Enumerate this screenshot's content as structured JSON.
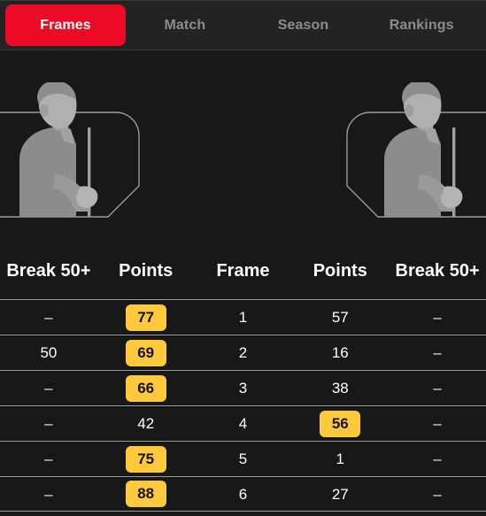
{
  "tabs": [
    {
      "label": "Frames",
      "active": true
    },
    {
      "label": "Match",
      "active": false
    },
    {
      "label": "Season",
      "active": false
    },
    {
      "label": "Rankings",
      "active": false
    }
  ],
  "players": [
    {
      "side": "left",
      "avatar_icon": "player-silhouette-icon"
    },
    {
      "side": "right",
      "avatar_icon": "player-silhouette-icon"
    }
  ],
  "table": {
    "headers": [
      "Break 50+",
      "Points",
      "Frame",
      "Points",
      "Break 50+"
    ],
    "rows": [
      {
        "cells": [
          {
            "text": "–",
            "highlight": false
          },
          {
            "text": "77",
            "highlight": true
          },
          {
            "text": "1",
            "highlight": false
          },
          {
            "text": "57",
            "highlight": false
          },
          {
            "text": "–",
            "highlight": false
          }
        ]
      },
      {
        "cells": [
          {
            "text": "50",
            "highlight": false
          },
          {
            "text": "69",
            "highlight": true
          },
          {
            "text": "2",
            "highlight": false
          },
          {
            "text": "16",
            "highlight": false
          },
          {
            "text": "–",
            "highlight": false
          }
        ]
      },
      {
        "cells": [
          {
            "text": "–",
            "highlight": false
          },
          {
            "text": "66",
            "highlight": true
          },
          {
            "text": "3",
            "highlight": false
          },
          {
            "text": "38",
            "highlight": false
          },
          {
            "text": "–",
            "highlight": false
          }
        ]
      },
      {
        "cells": [
          {
            "text": "–",
            "highlight": false
          },
          {
            "text": "42",
            "highlight": false
          },
          {
            "text": "4",
            "highlight": false
          },
          {
            "text": "56",
            "highlight": true
          },
          {
            "text": "–",
            "highlight": false
          }
        ]
      },
      {
        "cells": [
          {
            "text": "–",
            "highlight": false
          },
          {
            "text": "75",
            "highlight": true
          },
          {
            "text": "5",
            "highlight": false
          },
          {
            "text": "1",
            "highlight": false
          },
          {
            "text": "–",
            "highlight": false
          }
        ]
      },
      {
        "cells": [
          {
            "text": "–",
            "highlight": false
          },
          {
            "text": "88",
            "highlight": true
          },
          {
            "text": "6",
            "highlight": false
          },
          {
            "text": "27",
            "highlight": false
          },
          {
            "text": "–",
            "highlight": false
          }
        ]
      }
    ]
  },
  "colors": {
    "page_background": "#181818",
    "tabbar_background": "#232323",
    "active_tab": "#ED0A26",
    "active_tab_text": "#FFFFFF",
    "inactive_tab_text": "#8C8C8C",
    "highlight_badge": "#FFC93C",
    "highlight_badge_text": "#131313",
    "row_divider": "#9A9A9A",
    "value_text": "#FFFFFF",
    "silhouette": "#8C8C8C",
    "silhouette_light": "#A8A8A8",
    "avatar_frame_outline": "#9A9A9A"
  }
}
